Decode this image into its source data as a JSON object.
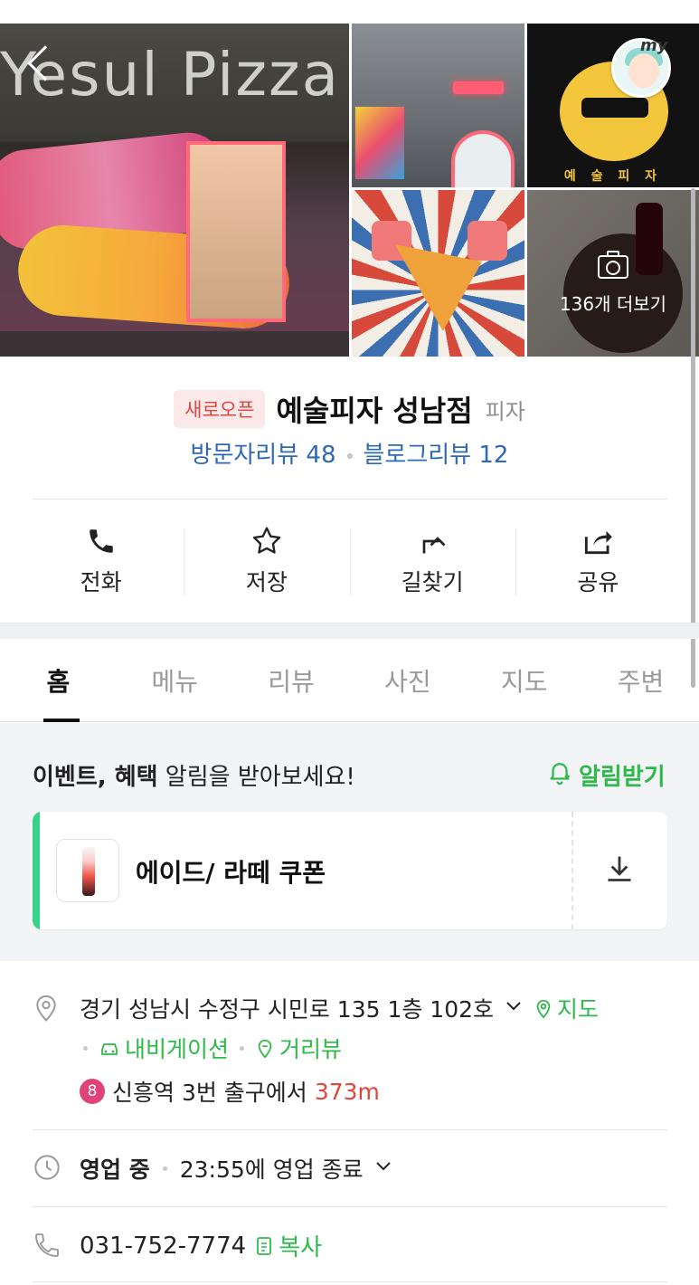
{
  "photos": {
    "sign_text": "Yesul Pizza",
    "more_label": "136개 더보기",
    "badge_text": "my",
    "poster_label": "예 술 피 자"
  },
  "place": {
    "badge": "새로오픈",
    "name": "예술피자 성남점",
    "category": "피자",
    "visitor_reviews": "방문자리뷰 48",
    "blog_reviews": "블로그리뷰 12"
  },
  "actions": {
    "call": "전화",
    "save": "저장",
    "directions": "길찾기",
    "share": "공유"
  },
  "tabs": [
    "홈",
    "메뉴",
    "리뷰",
    "사진",
    "지도",
    "주변"
  ],
  "notice": {
    "bold": "이벤트, 혜택",
    "rest": " 알림을 받아보세요!",
    "button": "알림받기"
  },
  "coupon": {
    "name": "에이드/ 라떼 쿠폰"
  },
  "info": {
    "address": "경기 성남시 수정구 시민로 135 1층 102호",
    "map_link": "지도",
    "navigation_link": "내비게이션",
    "streetview_link": "거리뷰",
    "subway_line": "8",
    "subway_text": "신흥역 3번 출구에서",
    "subway_distance": "373m",
    "status": "영업 중",
    "closing": "23:55에 영업 종료",
    "phone": "031-752-7774",
    "copy": "복사"
  },
  "colors": {
    "accent_green": "#2fb94a",
    "link_blue": "#2e68b6",
    "new_badge_red": "#e5433d",
    "coupon_bar": "#38d38a",
    "subway_line8": "#e0427a"
  }
}
